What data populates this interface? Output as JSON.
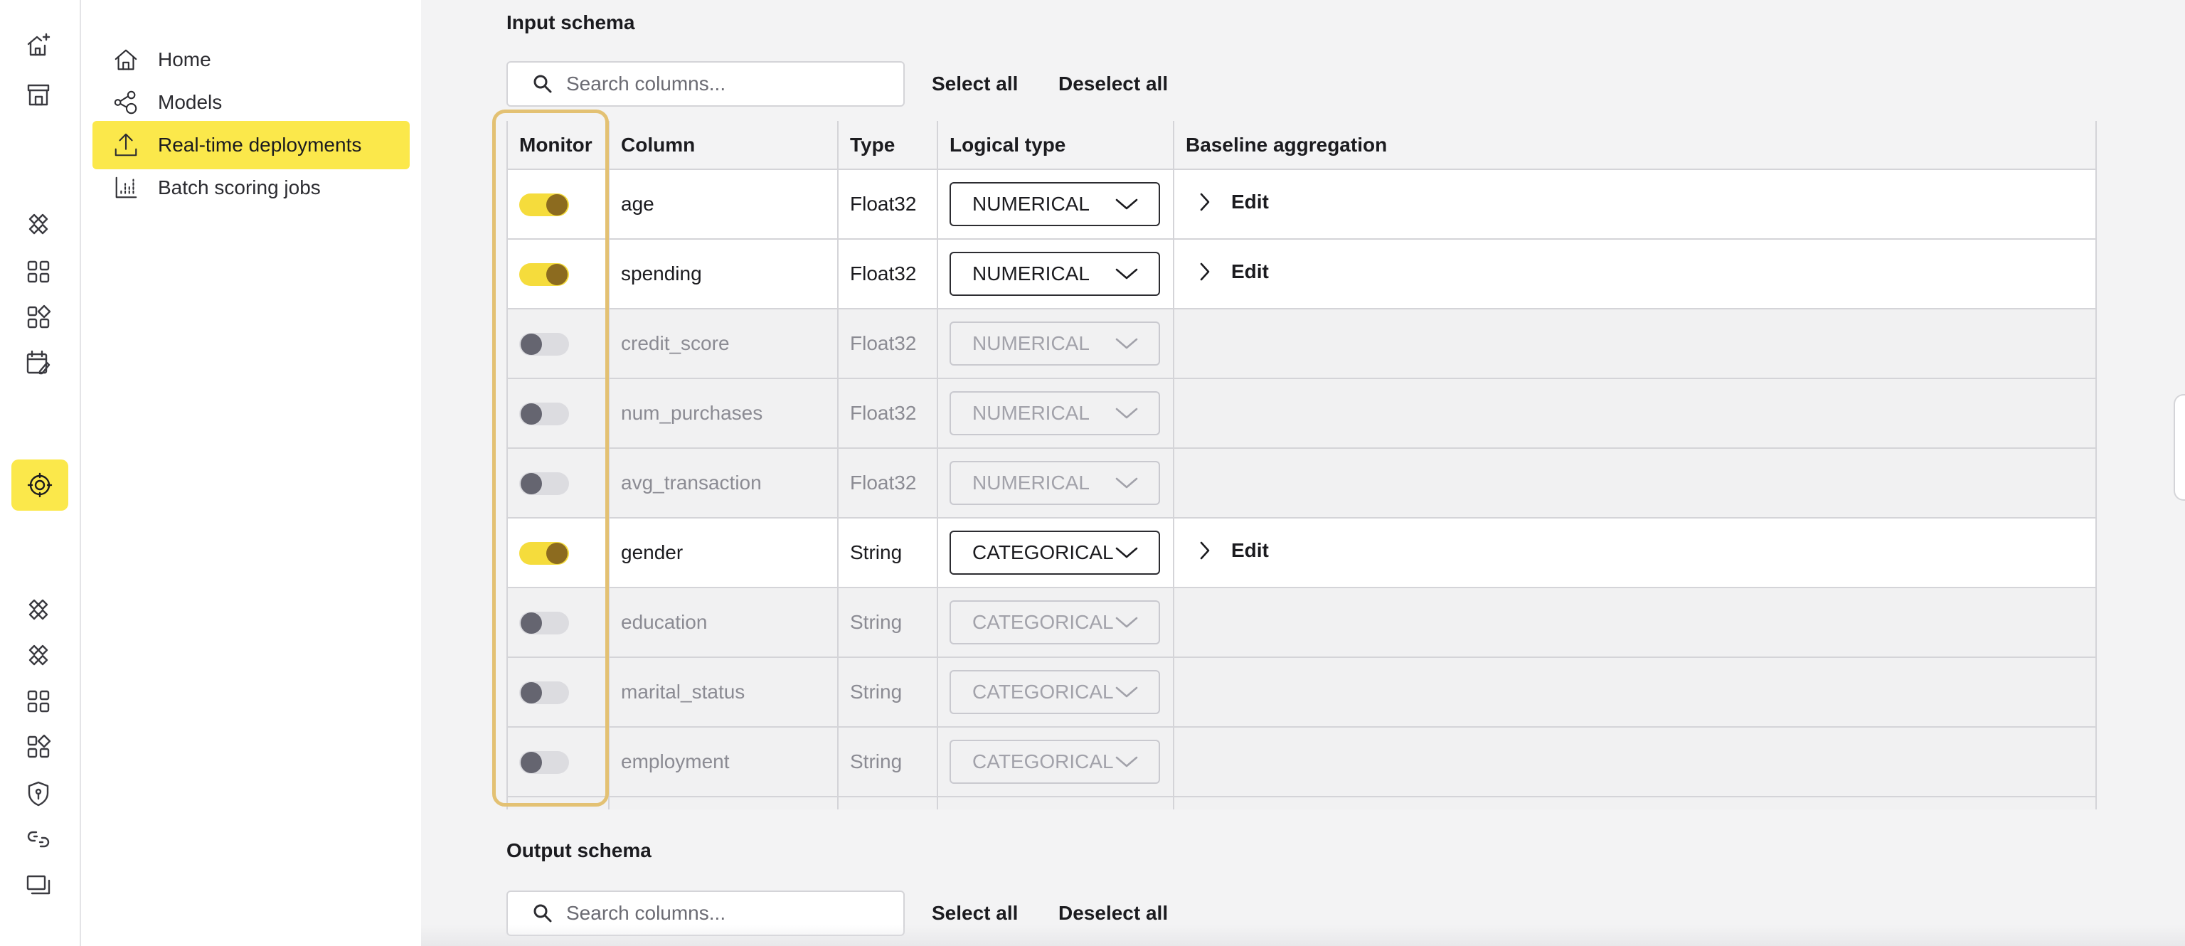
{
  "rail": {
    "icons": [
      "home-sparkle-icon",
      "store-icon",
      "network-icon",
      "grid-icon",
      "widgets-icon",
      "calendar-edit-icon",
      "deployments-icon",
      "network-icon",
      "network-icon",
      "grid-icon",
      "widgets-icon",
      "shield-icon",
      "link-icon",
      "windows-icon"
    ],
    "active": "deployments-icon"
  },
  "nav": {
    "items": [
      {
        "label": "Home",
        "icon": "home-icon"
      },
      {
        "label": "Models",
        "icon": "models-icon"
      },
      {
        "label": "Real-time deployments",
        "icon": "upload-icon"
      },
      {
        "label": "Batch scoring jobs",
        "icon": "chart-icon"
      }
    ],
    "active_index": 2
  },
  "input_schema": {
    "title": "Input schema",
    "search_placeholder": "Search columns...",
    "select_all": "Select all",
    "deselect_all": "Deselect all",
    "columns": [
      "Monitor",
      "Column",
      "Type",
      "Logical type",
      "Baseline aggregation"
    ],
    "rows": [
      {
        "monitor": true,
        "column": "age",
        "type": "Float32",
        "logical_type": "NUMERICAL",
        "aggregation": "Edit"
      },
      {
        "monitor": true,
        "column": "spending",
        "type": "Float32",
        "logical_type": "NUMERICAL",
        "aggregation": "Edit"
      },
      {
        "monitor": false,
        "column": "credit_score",
        "type": "Float32",
        "logical_type": "NUMERICAL",
        "aggregation": ""
      },
      {
        "monitor": false,
        "column": "num_purchases",
        "type": "Float32",
        "logical_type": "NUMERICAL",
        "aggregation": ""
      },
      {
        "monitor": false,
        "column": "avg_transaction",
        "type": "Float32",
        "logical_type": "NUMERICAL",
        "aggregation": ""
      },
      {
        "monitor": true,
        "column": "gender",
        "type": "String",
        "logical_type": "CATEGORICAL",
        "aggregation": "Edit"
      },
      {
        "monitor": false,
        "column": "education",
        "type": "String",
        "logical_type": "CATEGORICAL",
        "aggregation": ""
      },
      {
        "monitor": false,
        "column": "marital_status",
        "type": "String",
        "logical_type": "CATEGORICAL",
        "aggregation": ""
      },
      {
        "monitor": false,
        "column": "employment",
        "type": "String",
        "logical_type": "CATEGORICAL",
        "aggregation": ""
      }
    ]
  },
  "output_schema": {
    "title": "Output schema",
    "search_placeholder": "Search columns...",
    "select_all": "Select all",
    "deselect_all": "Deselect all"
  },
  "colors": {
    "accent": "#fbe84b",
    "toggle_on_track": "#f5dc3c",
    "toggle_on_knob": "#8c6b1f",
    "highlight_border": "#e3c173"
  }
}
